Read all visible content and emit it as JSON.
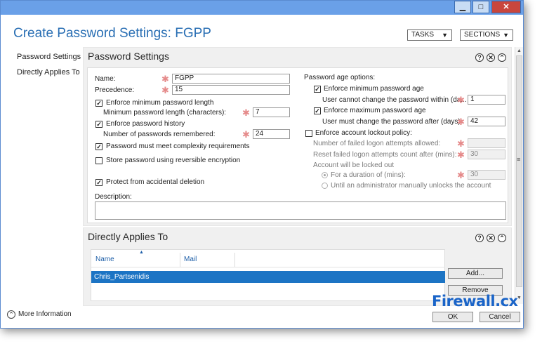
{
  "window": {
    "minimize_glyph": "▁",
    "maximize_glyph": "□",
    "close_glyph": "✕"
  },
  "header": {
    "title": "Create Password Settings: FGPP",
    "tasks_label": "TASKS",
    "sections_label": "SECTIONS",
    "caret": "▼"
  },
  "sidebar": {
    "items": [
      {
        "label": "Password Settings"
      },
      {
        "label": "Directly Applies To"
      }
    ]
  },
  "password_settings": {
    "title": "Password Settings",
    "help_glyph": "?",
    "close_glyph": "✕",
    "collapse_glyph": "⌃",
    "required_glyph": "✱",
    "check_glyph": "✓",
    "name_label": "Name:",
    "name_value": "FGPP",
    "precedence_label": "Precedence:",
    "precedence_value": "15",
    "enforce_min_length_label": "Enforce minimum password length",
    "enforce_min_length_checked": true,
    "min_length_label": "Minimum password length (characters):",
    "min_length_value": "7",
    "enforce_history_label": "Enforce password history",
    "enforce_history_checked": true,
    "history_label": "Number of passwords remembered:",
    "history_value": "24",
    "complexity_label": "Password must meet complexity requirements",
    "complexity_checked": true,
    "reversible_label": "Store password using reversible encryption",
    "reversible_checked": false,
    "protect_label": "Protect from accidental deletion",
    "protect_checked": true,
    "description_label": "Description:",
    "description_value": "",
    "age_options_label": "Password age options:",
    "enforce_min_age_label": "Enforce minimum password age",
    "enforce_min_age_checked": true,
    "min_age_label": "User cannot change the password within (da...",
    "min_age_value": "1",
    "enforce_max_age_label": "Enforce maximum password age",
    "enforce_max_age_checked": true,
    "max_age_label": "User must change the password after (days):",
    "max_age_value": "42",
    "lockout_label": "Enforce account lockout policy:",
    "lockout_checked": false,
    "failed_attempts_label": "Number of failed logon attempts allowed:",
    "failed_attempts_value": "",
    "reset_after_label": "Reset failed logon attempts count after (mins):",
    "reset_after_value": "30",
    "locked_out_label": "Account will be locked out",
    "duration_label": "For a duration of (mins):",
    "duration_value": "30",
    "manual_unlock_label": "Until an administrator manually unlocks the account"
  },
  "directly_applies_to": {
    "title": "Directly Applies To",
    "help_glyph": "?",
    "close_glyph": "✕",
    "collapse_glyph": "⌃",
    "columns": [
      "Name",
      "Mail"
    ],
    "sort_glyph": "▲",
    "rows": [
      {
        "name": "Chris_Partsenidis",
        "mail": ""
      }
    ],
    "add_label": "Add...",
    "remove_label": "Remove"
  },
  "scroll": {
    "up_glyph": "▲",
    "down_glyph": "▼",
    "grip_glyph": "≡"
  },
  "footer": {
    "more_info_glyph": "⌃",
    "more_info_label": "More Information",
    "ok_label": "OK",
    "cancel_label": "Cancel"
  },
  "brand": {
    "text": "Firewall.cx"
  }
}
